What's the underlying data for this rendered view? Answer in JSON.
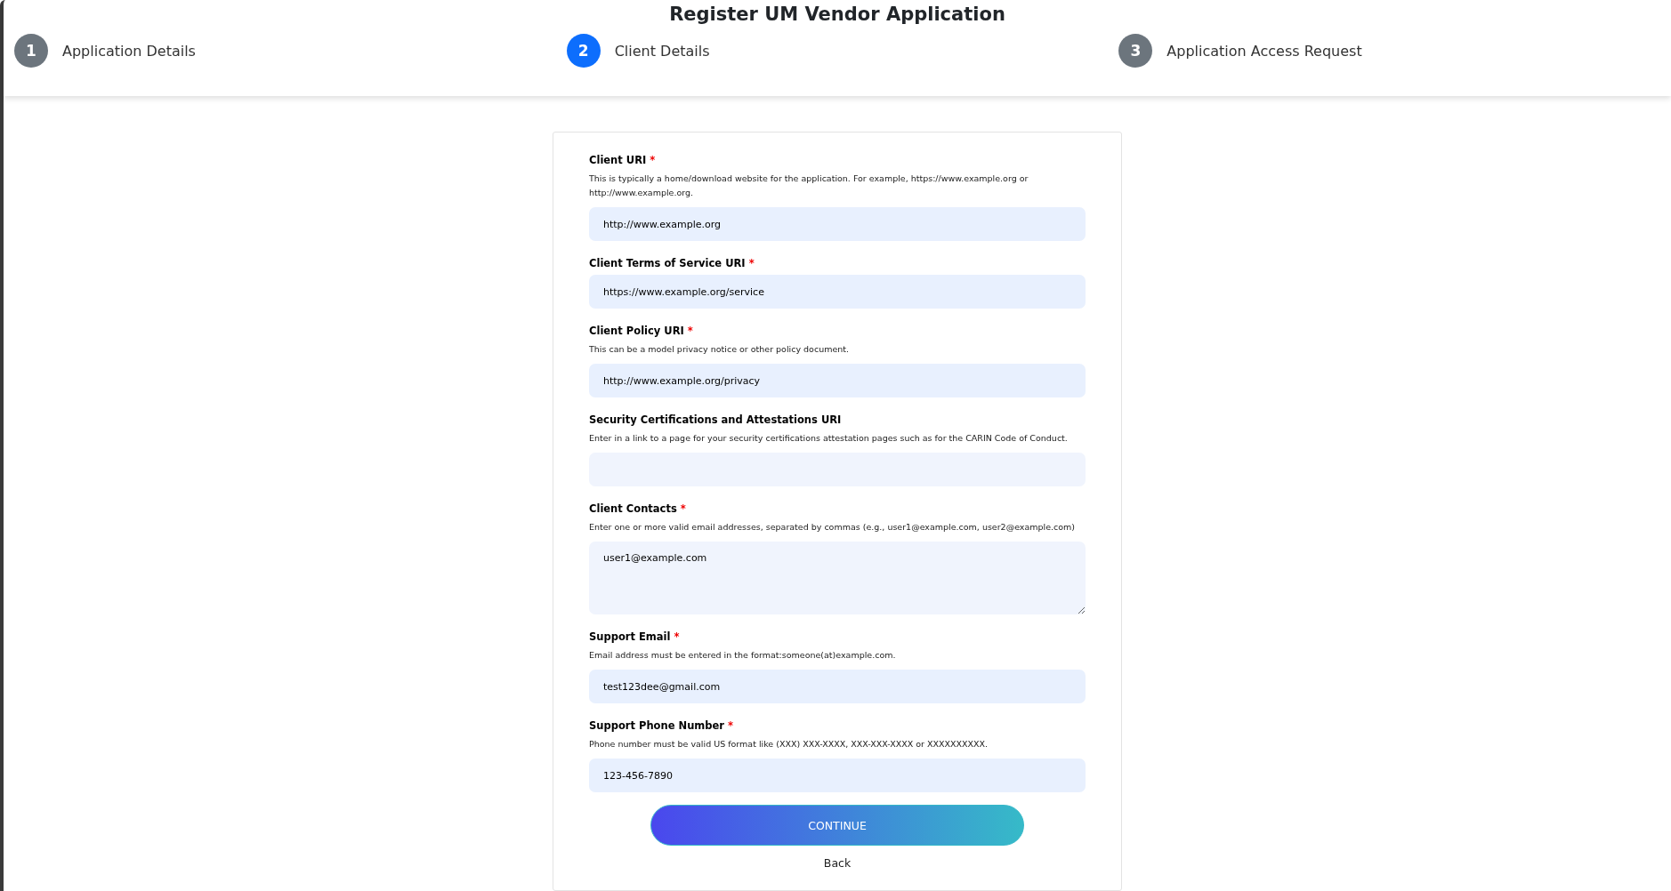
{
  "title": "Register UM Vendor Application",
  "steps": [
    {
      "number": "1",
      "label": "Application Details",
      "selected": false
    },
    {
      "number": "2",
      "label": "Client Details",
      "selected": true
    },
    {
      "number": "3",
      "label": "Application Access Request",
      "selected": false
    }
  ],
  "fields": [
    {
      "label": "Client URI",
      "required_mark": "*",
      "help": "This is typically a home/download website for the application. For example, https://www.example.org or http://www.example.org.",
      "kind": "input",
      "value": "http://www.example.org"
    },
    {
      "label": "Client Terms of Service URI",
      "required_mark": "*",
      "kind": "input",
      "value": "https://www.example.org/service"
    },
    {
      "label": "Client Policy URI",
      "required_mark": "*",
      "help": "This can be a model privacy notice or other policy document.",
      "kind": "input",
      "value": "http://www.example.org/privacy"
    },
    {
      "label": "Security Certifications and Attestations URI",
      "help": "Enter in a link to a page for your security certifications attestation pages such as for the CARIN Code of Conduct.",
      "kind": "input"
    },
    {
      "label": "Client Contacts",
      "required_mark": "*",
      "help": "Enter one or more valid email addresses, separated by commas (e.g., user1@example.com, user2@example.com)",
      "kind": "textarea",
      "value": "user1@example.com"
    },
    {
      "label": "Support Email",
      "required_mark": "*",
      "help": "Email address must be entered in the format:someone(at)example.com.",
      "kind": "input",
      "value": "test123dee@gmail.com"
    },
    {
      "label": "Support Phone Number",
      "required_mark": "*",
      "help": "Phone number must be valid US format like (XXX) XXX-XXXX, XXX-XXX-XXXX or XXXXXXXXXX.",
      "kind": "input",
      "value": "123-456-7890"
    }
  ],
  "continue_button": "CONTINUE",
  "back_link": "Back"
}
